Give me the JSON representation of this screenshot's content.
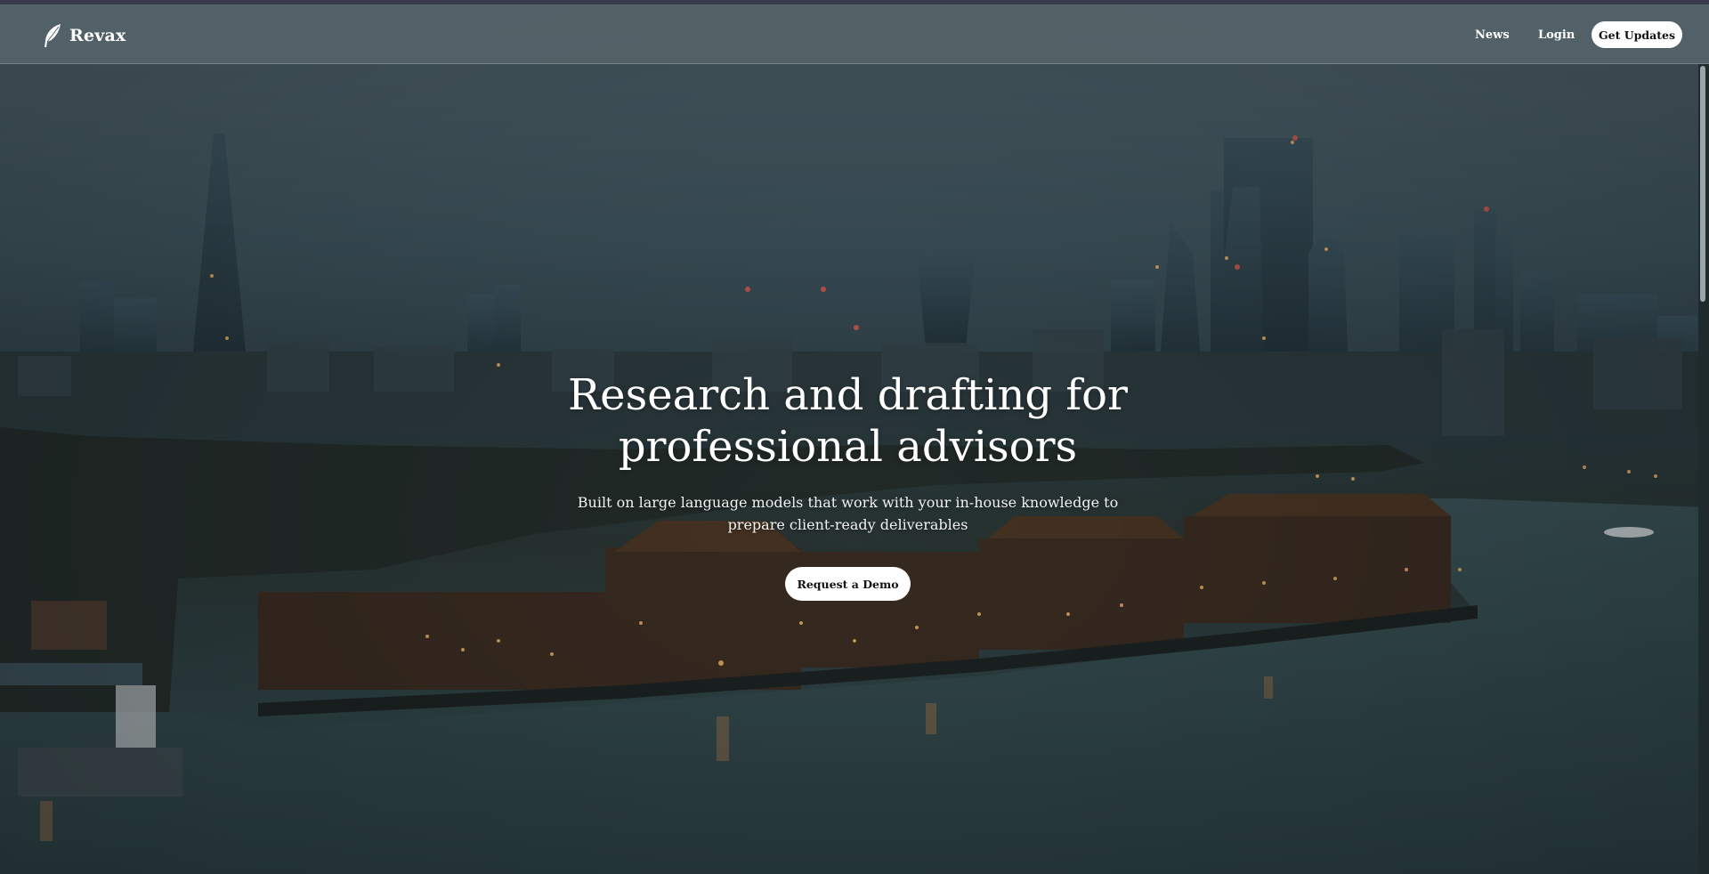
{
  "nav": {
    "brand": "Revax",
    "links": [
      "News",
      "Login"
    ],
    "cta_label": "Get Updates",
    "logo_icon": "feather-icon"
  },
  "hero": {
    "headline": "Research and drafting for professional advisors",
    "subheadline": "Built on large language models that work with your in-house knowledge to prepare client-ready deliverables",
    "cta_label": "Request a Demo",
    "background_image": "city skyline at dusk over a river"
  },
  "colors": {
    "nav_bg": "#556369",
    "button_bg": "#ffffff",
    "text": "#ffffff"
  }
}
